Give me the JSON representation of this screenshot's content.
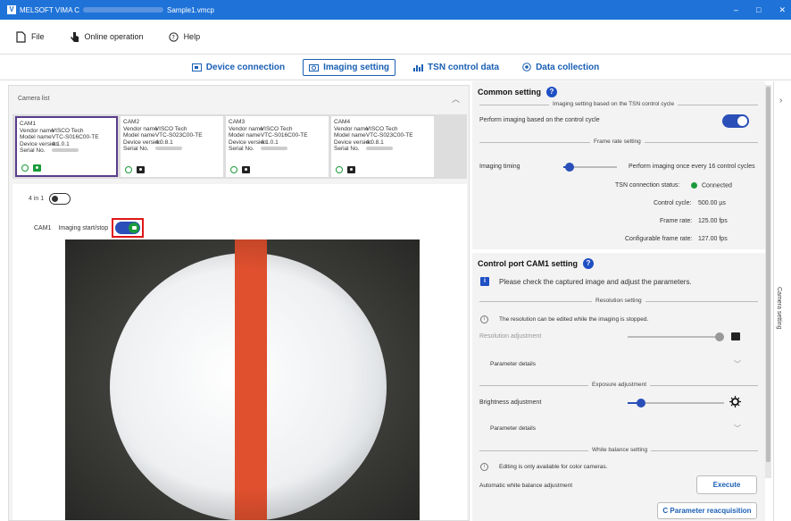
{
  "window": {
    "title_prefix": "MELSOFT VIMA C",
    "title_suffix": "Sample1.vmcp",
    "min": "–",
    "max": "□",
    "close": "✕"
  },
  "menu": {
    "file": "File",
    "online": "Online operation",
    "help": "Help"
  },
  "tabs": [
    {
      "label": "Device connection"
    },
    {
      "label": "Imaging setting"
    },
    {
      "label": "TSN control data"
    },
    {
      "label": "Data collection"
    }
  ],
  "camera_list": {
    "title": "Camera list",
    "cameras": [
      {
        "name": "CAM1",
        "vendor_lbl": "Vendor name",
        "vendor": "VISCO Tech",
        "model_lbl": "Model name",
        "model": "VTC-S016C00-TE",
        "dev_lbl": "Device version",
        "dev": "4.1.0.1",
        "serial_lbl": "Serial No."
      },
      {
        "name": "CAM2",
        "vendor_lbl": "Vendor name",
        "vendor": "VISCO Tech",
        "model_lbl": "Model name",
        "model": "VTC-S023C00-TE",
        "dev_lbl": "Device version",
        "dev": "4.0.8.1",
        "serial_lbl": "Serial No."
      },
      {
        "name": "CAM3",
        "vendor_lbl": "Vendor name",
        "vendor": "VISCO Tech",
        "model_lbl": "Model name",
        "model": "VTC-S016C00-TE",
        "dev_lbl": "Device version",
        "dev": "4.1.0.1",
        "serial_lbl": "Serial No."
      },
      {
        "name": "CAM4",
        "vendor_lbl": "Vendor name",
        "vendor": "VISCO Tech",
        "model_lbl": "Model name",
        "model": "VTC-S023C00-TE",
        "dev_lbl": "Device version",
        "dev": "4.0.8.1",
        "serial_lbl": "Serial No."
      }
    ]
  },
  "viewer": {
    "four_in_one": "4 in 1",
    "cam": "CAM1",
    "imaging_start_stop": "Imaging start/stop"
  },
  "common": {
    "title": "Common setting",
    "tsn_divider": "Imaging setting based on the TSN control cycle",
    "perform_label": "Perform imaging based on the control cycle",
    "frame_divider": "Frame rate setting",
    "timing_label": "Imaging timing",
    "timing_value": "Perform imaging once every 16 control cycles",
    "tsn_status_lbl": "TSN connection status:",
    "tsn_status_val": "Connected",
    "cycle_lbl": "Control cycle:",
    "cycle_val": "500.00 µs",
    "frame_lbl": "Frame rate:",
    "frame_val": "125.00 fps",
    "cfg_lbl": "Configurable frame rate:",
    "cfg_val": "127.00 fps"
  },
  "port": {
    "title": "Control port CAM1 setting",
    "info": "Please check the captured image and adjust the parameters.",
    "res_divider": "Resolution setting",
    "res_note": "The resolution can be edited while the imaging is stopped.",
    "res_adjust": "Resolution adjustment",
    "param_details_1": "Parameter details",
    "exp_divider": "Exposure adjustment",
    "brightness": "Brightness adjustment",
    "param_details_2": "Parameter details",
    "wb_divider": "White balance setting",
    "wb_note": "Editing is only available for color cameras.",
    "wb_auto": "Automatic white balance adjustment",
    "execute": "Execute",
    "reacq": "Parameter reacquisition"
  },
  "side": {
    "label": "Camera setting"
  },
  "slider_levels": {
    "imaging_timing": 0.03,
    "resolution": 1.0,
    "brightness": 0.1
  }
}
